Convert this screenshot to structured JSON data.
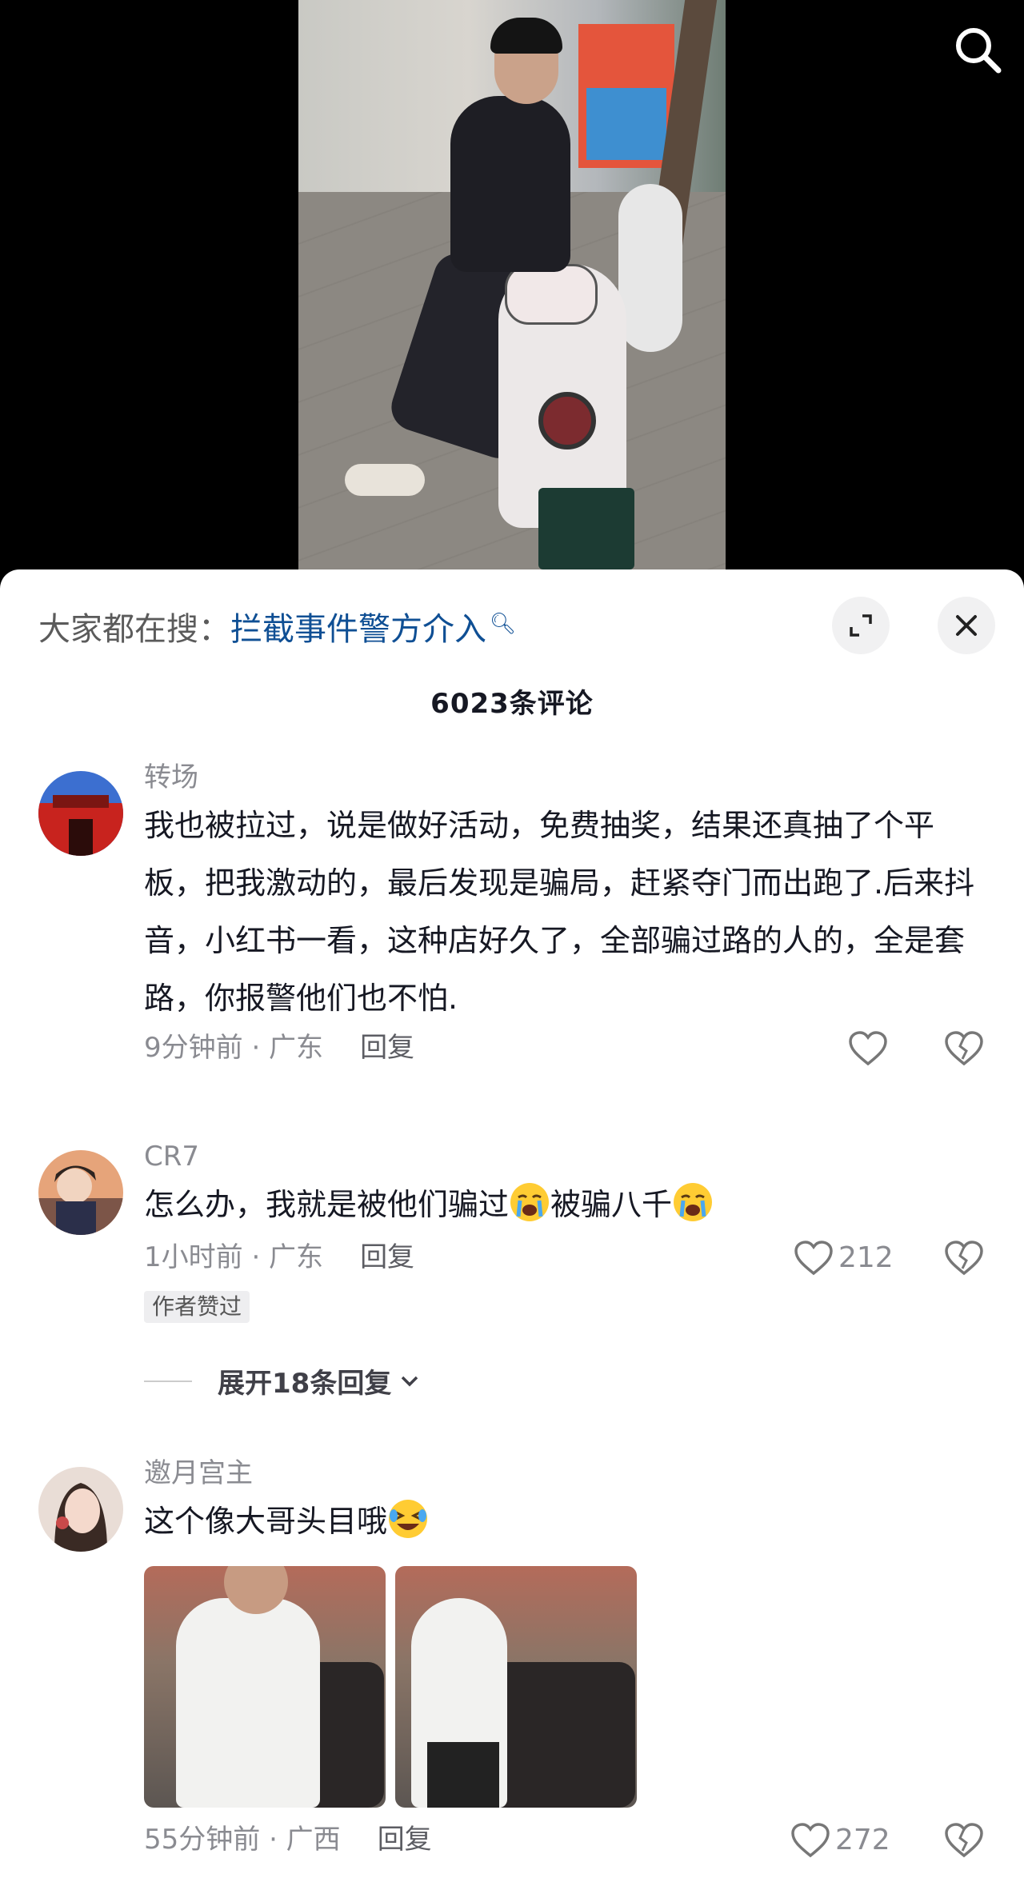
{
  "hot_search": {
    "prefix": "大家都在搜：",
    "term": "拦截事件警方介入"
  },
  "comment_count_label": "6023条评论",
  "comments": [
    {
      "user": "转场",
      "text": "我也被拉过，说是做好活动，免费抽奖，结果还真抽了个平板，把我激动的，最后发现是骗局，赶紧夺门而出跑了.后来抖音，小红书一看，这种店好久了，全部骗过路的人的，全是套路，你报警他们也不怕.",
      "time_loc": "9分钟前 · 广东",
      "reply": "回复",
      "likes": ""
    },
    {
      "user": "CR7",
      "text_part1": "怎么办，我就是被他们骗过",
      "text_part2": "被骗八千",
      "emoji": "crying-face",
      "time_loc": "1小时前 · 广东",
      "reply": "回复",
      "likes": "212",
      "badge": "作者赞过",
      "expand_replies": "展开18条回复"
    },
    {
      "user": "邀月宫主",
      "text": "这个像大哥头目哦",
      "emoji": "laughing-tears-face",
      "time_loc": "55分钟前 · 广西",
      "reply": "回复",
      "likes": "272"
    }
  ],
  "colors": {
    "link_blue": "#0f4f94",
    "meta_gray": "#8a8b91"
  }
}
